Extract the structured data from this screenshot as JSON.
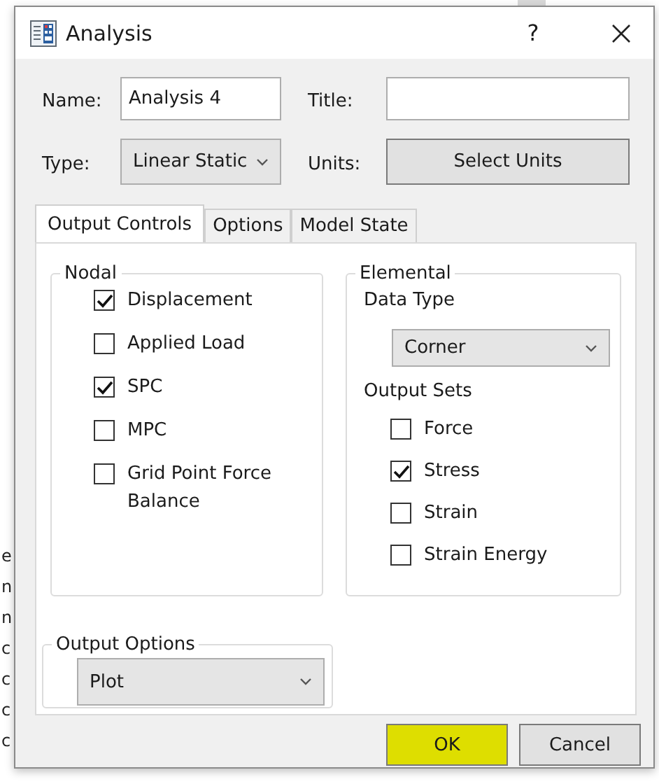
{
  "background": {
    "lines": [
      "e",
      "n",
      "n",
      "c",
      "c",
      "c",
      "c"
    ]
  },
  "window": {
    "title": "Analysis",
    "help": "?"
  },
  "name": {
    "label": "Name:",
    "value": "Analysis 4"
  },
  "title_field": {
    "label": "Title:"
  },
  "type": {
    "label": "Type:",
    "value": "Linear Static"
  },
  "units": {
    "label": "Units:",
    "button": "Select Units"
  },
  "tabs": [
    {
      "label": "Output Controls",
      "selected": true
    },
    {
      "label": "Options",
      "selected": false
    },
    {
      "label": "Model State",
      "selected": false
    }
  ],
  "nodal": {
    "title": "Nodal",
    "items": [
      {
        "label": "Displacement",
        "checked": true
      },
      {
        "label": "Applied Load",
        "checked": false
      },
      {
        "label": "SPC",
        "checked": true
      },
      {
        "label": "MPC",
        "checked": false
      },
      {
        "label": "Grid Point Force Balance",
        "checked": false
      }
    ]
  },
  "elemental": {
    "title": "Elemental",
    "data_type_label": "Data Type",
    "data_type": "Corner",
    "output_sets_label": "Output Sets",
    "items": [
      {
        "label": "Force",
        "checked": false
      },
      {
        "label": "Stress",
        "checked": true
      },
      {
        "label": "Strain",
        "checked": false
      },
      {
        "label": "Strain Energy",
        "checked": false
      }
    ]
  },
  "output_options": {
    "title": "Output Options",
    "value": "Plot"
  },
  "buttons": [
    {
      "label": "OK",
      "highlighted": true
    },
    {
      "label": "Cancel",
      "highlighted": false
    }
  ]
}
